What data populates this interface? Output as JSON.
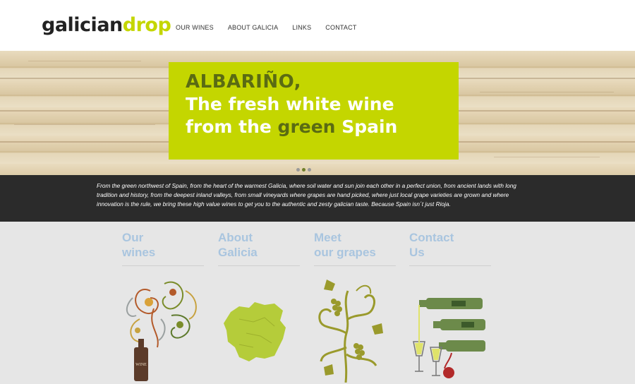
{
  "brand": {
    "logo_main": "galician",
    "logo_accent": "drop"
  },
  "nav": [
    {
      "label": "OUR WINES"
    },
    {
      "label": "ABOUT GALICIA"
    },
    {
      "label": "LINKS"
    },
    {
      "label": "CONTACT"
    }
  ],
  "hero": {
    "line1": "ALBARIÑO,",
    "line2": "The fresh white wine",
    "line3_pre": "from the ",
    "line3_green": "green",
    "line3_post": " Spain",
    "slides": 3,
    "active_slide": 1
  },
  "intro": {
    "text": "From the green northwest of Spain, from the heart of the warmest Galicia, where soil water and sun join each other in a perfect union, from ancient lands with long tradition and history, from the deepest inland valleys, from small vineyards where grapes are hand picked, where just local grape varieties are grown and where innovation is the rule, we bring these high value wines to get you to the authentic and zesty galician taste. Because Spain isn´t just Rioja."
  },
  "columns": [
    {
      "line1": "Our",
      "line2": "wines",
      "icon": "wine-bottle-swirl-illustration"
    },
    {
      "line1": "About",
      "line2": "Galicia",
      "icon": "galicia-map-illustration"
    },
    {
      "line1": "Meet",
      "line2": "our grapes",
      "icon": "grapevine-illustration"
    },
    {
      "line1": "Contact",
      "line2": "Us",
      "icon": "wine-glasses-bottles-illustration"
    }
  ],
  "colors": {
    "accent": "#c4d600",
    "accent_dark": "#5a6b13",
    "column_heading": "#a9c5df",
    "intro_bg": "#2b2b2b"
  },
  "bottle_label": "WINE"
}
